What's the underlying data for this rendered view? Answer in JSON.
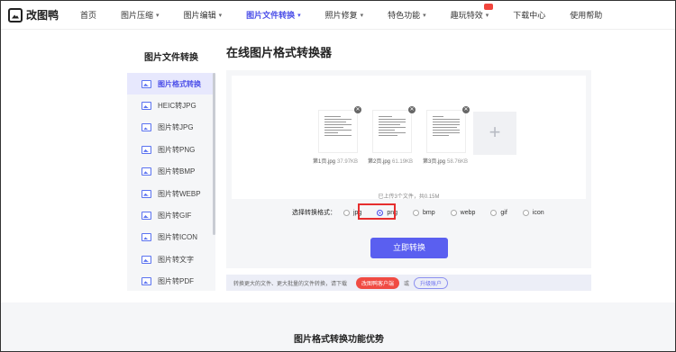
{
  "brand": {
    "name": "改图鸭"
  },
  "nav": [
    {
      "label": "首页",
      "dropdown": false,
      "active": false
    },
    {
      "label": "图片压缩",
      "dropdown": true,
      "active": false
    },
    {
      "label": "图片编辑",
      "dropdown": true,
      "active": false
    },
    {
      "label": "图片文件转换",
      "dropdown": true,
      "active": true
    },
    {
      "label": "照片修复",
      "dropdown": true,
      "active": false
    },
    {
      "label": "特色功能",
      "dropdown": true,
      "active": false
    },
    {
      "label": "趣玩特效",
      "dropdown": true,
      "active": false
    },
    {
      "label": "下载中心",
      "dropdown": false,
      "active": false
    },
    {
      "label": "使用帮助",
      "dropdown": false,
      "active": false
    }
  ],
  "sidebar": {
    "title": "图片文件转换",
    "items": [
      {
        "label": "图片格式转换",
        "active": true
      },
      {
        "label": "HEIC转JPG",
        "active": false
      },
      {
        "label": "图片转JPG",
        "active": false
      },
      {
        "label": "图片转PNG",
        "active": false
      },
      {
        "label": "图片转BMP",
        "active": false
      },
      {
        "label": "图片转WEBP",
        "active": false
      },
      {
        "label": "图片转GIF",
        "active": false
      },
      {
        "label": "图片转ICON",
        "active": false
      },
      {
        "label": "图片转文字",
        "active": false
      },
      {
        "label": "图片转PDF",
        "active": false
      }
    ]
  },
  "main": {
    "title": "在线图片格式转换器",
    "files": [
      {
        "name": "第1页.jpg",
        "size": "37.97KB"
      },
      {
        "name": "第2页.jpg",
        "size": "61.19KB"
      },
      {
        "name": "第3页.jpg",
        "size": "58.76KB"
      }
    ],
    "upload_info": "已上传3个文件，共0.15M",
    "format_label": "选择转换格式：",
    "formats": [
      {
        "label": "jpg",
        "selected": false
      },
      {
        "label": "png",
        "selected": true
      },
      {
        "label": "bmp",
        "selected": false
      },
      {
        "label": "webp",
        "selected": false
      },
      {
        "label": "gif",
        "selected": false
      },
      {
        "label": "icon",
        "selected": false
      }
    ],
    "convert_button": "立即转换"
  },
  "promo": {
    "text": "转换更大的文件、更大批量的文件转换，请下载",
    "download_button": "改图鸭客户端",
    "or": "或",
    "upgrade_button": "升级账户"
  },
  "footer_section": {
    "title": "图片格式转换功能优势"
  },
  "colors": {
    "accent": "#4b4ee8",
    "button": "#5a5ff0",
    "highlight": "#e62e2e",
    "promo_red": "#f04b43"
  },
  "icons": {
    "logo": "image-icon",
    "file": "image-file-icon",
    "add": "plus-icon",
    "remove": "close-icon",
    "dropdown": "chevron-down-icon"
  }
}
